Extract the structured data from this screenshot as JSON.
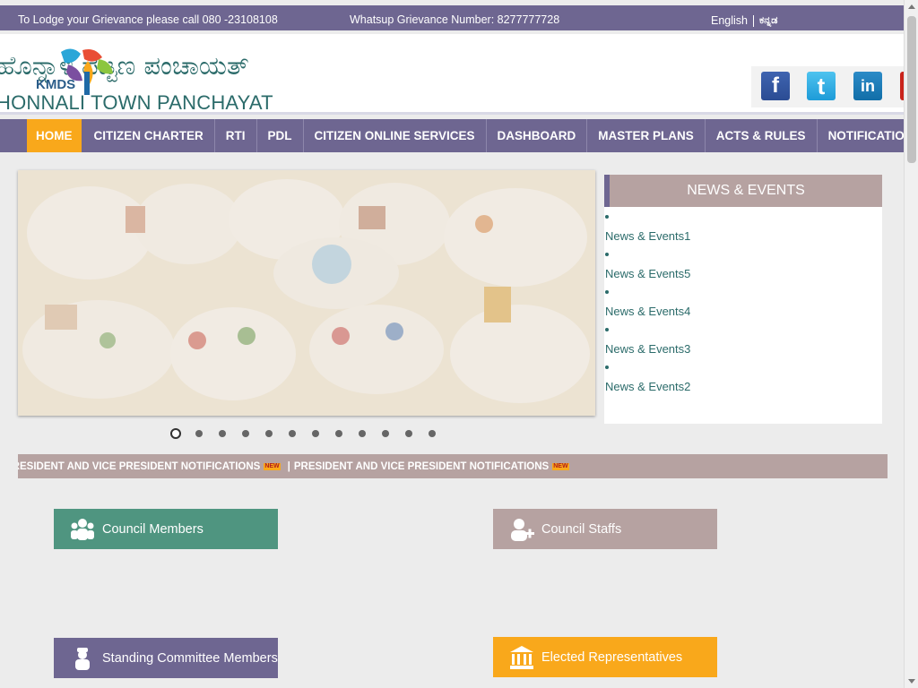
{
  "topbar": {
    "grievance_call": "To Lodge your Grievance please call 080 -23108108",
    "whatsapp": "Whatsup Grievance Number: 8277777728",
    "lang_english": "English",
    "lang_kannada": "ಕನ್ನಡ"
  },
  "header": {
    "title_kannada": "ಹೊನ್ನಾಳಿ ಪಟ್ಟಣ ಪಂಚಾಯತ್",
    "title_english": "HONNALI TOWN PANCHAYAT",
    "logo_text": "KMDS"
  },
  "social": {
    "facebook_glyph": "f",
    "twitter_glyph": "t",
    "linkedin_glyph": "in"
  },
  "nav": {
    "items": [
      {
        "label": "HOME"
      },
      {
        "label": "CITIZEN CHARTER"
      },
      {
        "label": "RTI"
      },
      {
        "label": "PDL"
      },
      {
        "label": "CITIZEN ONLINE SERVICES"
      },
      {
        "label": "DASHBOARD"
      },
      {
        "label": "MASTER PLANS"
      },
      {
        "label": "ACTS & RULES"
      },
      {
        "label": "NOTIFICATIONS"
      }
    ]
  },
  "news": {
    "heading": "NEWS & EVENTS",
    "items": [
      {
        "label": "News & Events1"
      },
      {
        "label": "News & Events5"
      },
      {
        "label": "News & Events4"
      },
      {
        "label": "News & Events3"
      },
      {
        "label": "News & Events2"
      }
    ]
  },
  "slider": {
    "slide_count": 12,
    "active_slide": 1
  },
  "marquee": {
    "text1": "PRESIDENT AND VICE PRESIDENT NOTIFICATIONS",
    "text2": "PRESIDENT AND VICE PRESIDENT NOTIFICATIONS",
    "separator": "|",
    "badge": "NEW"
  },
  "tiles": {
    "council_members": "Council Members",
    "council_staffs": "Council Staffs",
    "standing_committee": "Standing Committee Members",
    "elected_representatives": "Elected Representatives"
  },
  "colors": {
    "primary": "#6e6691",
    "accent": "#f9a81b",
    "muted": "#b6a2a1",
    "green": "#4f9580",
    "text_teal": "#2b6b6a"
  }
}
